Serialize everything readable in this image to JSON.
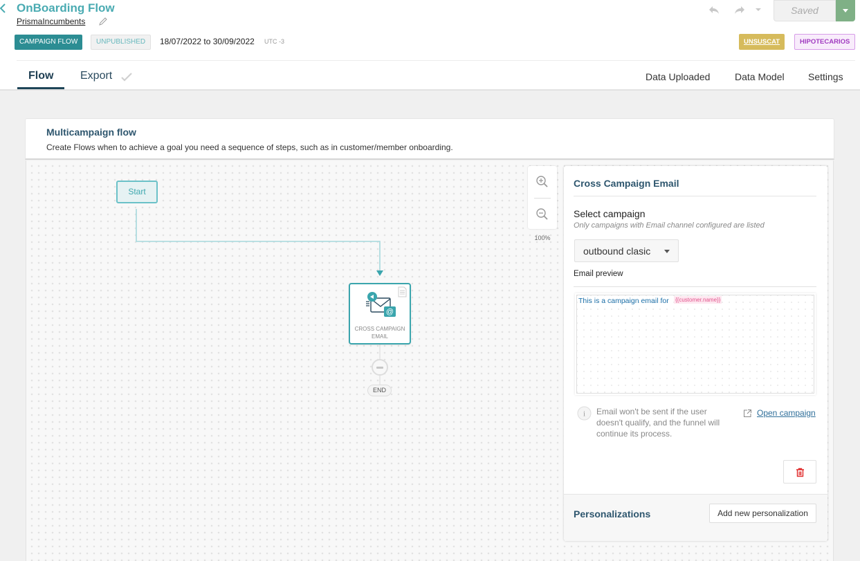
{
  "header": {
    "title": "OnBoarding Flow",
    "subtitle": "PrismaIncumbents",
    "badges": {
      "type": "CAMPAIGN FLOW",
      "status": "UNPUBLISHED"
    },
    "date_range": "18/07/2022 to 30/09/2022",
    "timezone": "UTC -3",
    "save_status": "Saved",
    "tags": [
      "UNSUSCAT",
      "HIPOTECARIOS"
    ],
    "colors": {
      "accent": "#4aabb2",
      "campaign_badge": "#2c8d93",
      "saved_caret": "#7fb086",
      "tag_unsuscat": "#d6bb5c",
      "tag_hipotecarios": "#a03bc0"
    }
  },
  "tabs": {
    "left": [
      {
        "label": "Flow",
        "active": true
      },
      {
        "label": "Export",
        "active": false,
        "icon": "check-icon"
      }
    ],
    "right": [
      {
        "label": "Data Uploaded"
      },
      {
        "label": "Data Model"
      },
      {
        "label": "Settings"
      }
    ]
  },
  "flow_card": {
    "title": "Multicampaign flow",
    "description": "Create Flows when to achieve a goal you need a sequence of steps, such as in customer/member onboarding."
  },
  "canvas": {
    "nodes": {
      "start": "Start",
      "email_node_label": "CROSS CAMPAIGN EMAIL",
      "end": "END"
    },
    "zoom_level": "100%"
  },
  "panel": {
    "title": "Cross Campaign Email",
    "select_label": "Select campaign",
    "select_help": "Only campaigns with Email channel configured are listed",
    "selected_campaign": "outbound clasic",
    "email_preview_label": "Email preview",
    "preview_text": "This is a campaign email for",
    "preview_token": "{{customer.name}}",
    "info_text": "Email won't be sent if the user doesn't qualify, and the funnel will continue its process.",
    "open_campaign": "Open campaign",
    "personalizations_label": "Personalizations",
    "add_personalization": "Add new personalization"
  }
}
